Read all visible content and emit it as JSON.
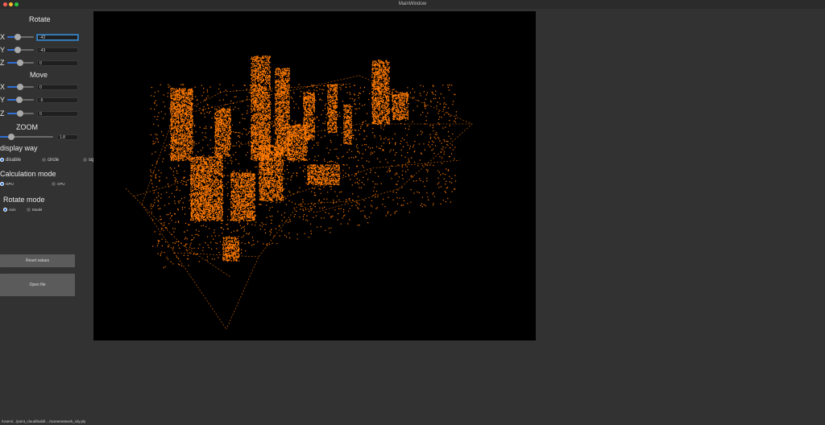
{
  "window": {
    "title": "MainWindow"
  },
  "rotate": {
    "heading": "Rotate",
    "x": {
      "label": "X",
      "value": "-42",
      "slider_percent": 39
    },
    "y": {
      "label": "Y",
      "value": "-43",
      "slider_percent": 37
    },
    "z": {
      "label": "Z",
      "value": "0",
      "slider_percent": 50
    }
  },
  "move": {
    "heading": "Move",
    "x": {
      "label": "X",
      "value": "0",
      "slider_percent": 50
    },
    "y": {
      "label": "Y",
      "value": "-5",
      "slider_percent": 46
    },
    "z": {
      "label": "Z",
      "value": "0",
      "slider_percent": 50
    }
  },
  "zoom": {
    "heading": "ZOOM",
    "value": "1.8",
    "slider_percent": 12
  },
  "display_way": {
    "heading": "display way",
    "options": [
      "disable",
      "circle",
      "square"
    ],
    "selected": "disable"
  },
  "calculation_mode": {
    "heading": "Calculation mode",
    "options": [
      "GPU",
      "CPU"
    ],
    "selected": "GPU"
  },
  "rotate_mode": {
    "heading": "Rotate mode",
    "options": [
      "Axis",
      "Model"
    ],
    "selected": "Axis"
  },
  "buttons": {
    "reset_values": "Reset values",
    "open_file": "Open file"
  },
  "status_bar": {
    "text": "/Users/.../point_cloud/build/..../scenenetwork_city.ply"
  },
  "colors": {
    "point_cloud": "#ff7a00",
    "viewport_bg": "#000000",
    "accent": "#2f6fd6"
  }
}
